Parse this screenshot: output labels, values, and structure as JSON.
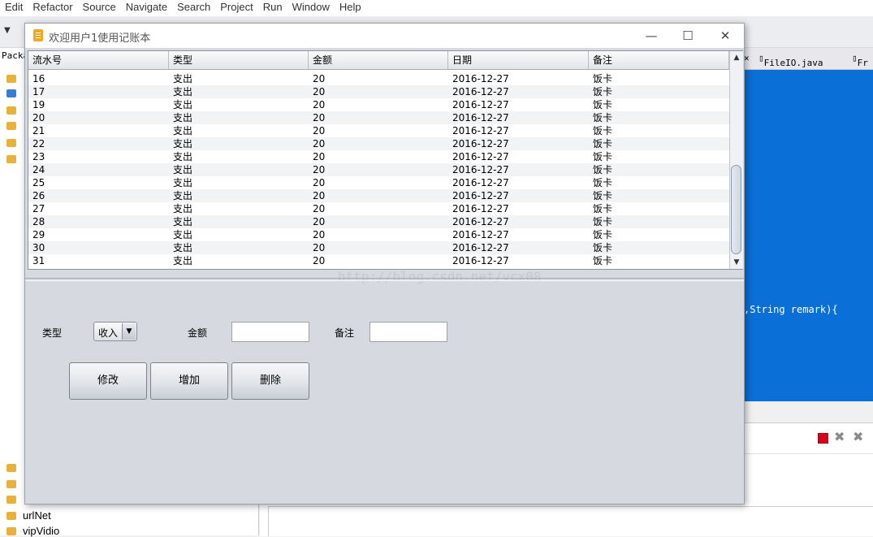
{
  "eclipse": {
    "menu": [
      "Edit",
      "Refactor",
      "Source",
      "Navigate",
      "Search",
      "Project",
      "Run",
      "Window",
      "Help"
    ],
    "left_tab": "Packa",
    "editor_tabs": [
      "FileIO.java",
      "Fr"
    ],
    "code_fragment": ",String remark){",
    "tree_items": [
      "urlNet",
      "vipVidio"
    ]
  },
  "window": {
    "title": "欢迎用户1使用记账本",
    "minimize": "—",
    "maximize": "☐",
    "close": "✕"
  },
  "table": {
    "columns": [
      "流水号",
      "类型",
      "金额",
      "日期",
      "备注"
    ],
    "rows": [
      [
        "16",
        "支出",
        "20",
        "2016-12-27",
        "饭卡"
      ],
      [
        "17",
        "支出",
        "20",
        "2016-12-27",
        "饭卡"
      ],
      [
        "19",
        "支出",
        "20",
        "2016-12-27",
        "饭卡"
      ],
      [
        "20",
        "支出",
        "20",
        "2016-12-27",
        "饭卡"
      ],
      [
        "21",
        "支出",
        "20",
        "2016-12-27",
        "饭卡"
      ],
      [
        "22",
        "支出",
        "20",
        "2016-12-27",
        "饭卡"
      ],
      [
        "23",
        "支出",
        "20",
        "2016-12-27",
        "饭卡"
      ],
      [
        "24",
        "支出",
        "20",
        "2016-12-27",
        "饭卡"
      ],
      [
        "25",
        "支出",
        "20",
        "2016-12-27",
        "饭卡"
      ],
      [
        "26",
        "支出",
        "20",
        "2016-12-27",
        "饭卡"
      ],
      [
        "27",
        "支出",
        "20",
        "2016-12-27",
        "饭卡"
      ],
      [
        "28",
        "支出",
        "20",
        "2016-12-27",
        "饭卡"
      ],
      [
        "29",
        "支出",
        "20",
        "2016-12-27",
        "饭卡"
      ],
      [
        "30",
        "支出",
        "20",
        "2016-12-27",
        "饭卡"
      ],
      [
        "31",
        "支出",
        "20",
        "2016-12-27",
        "饭卡"
      ]
    ]
  },
  "form": {
    "type_label": "类型",
    "type_value": "收入",
    "amount_label": "金额",
    "amount_value": "",
    "remark_label": "备注",
    "remark_value": ""
  },
  "buttons": {
    "edit": "修改",
    "add": "增加",
    "delete": "删除"
  },
  "watermark": "http://blog.csdn.net/vcx08"
}
